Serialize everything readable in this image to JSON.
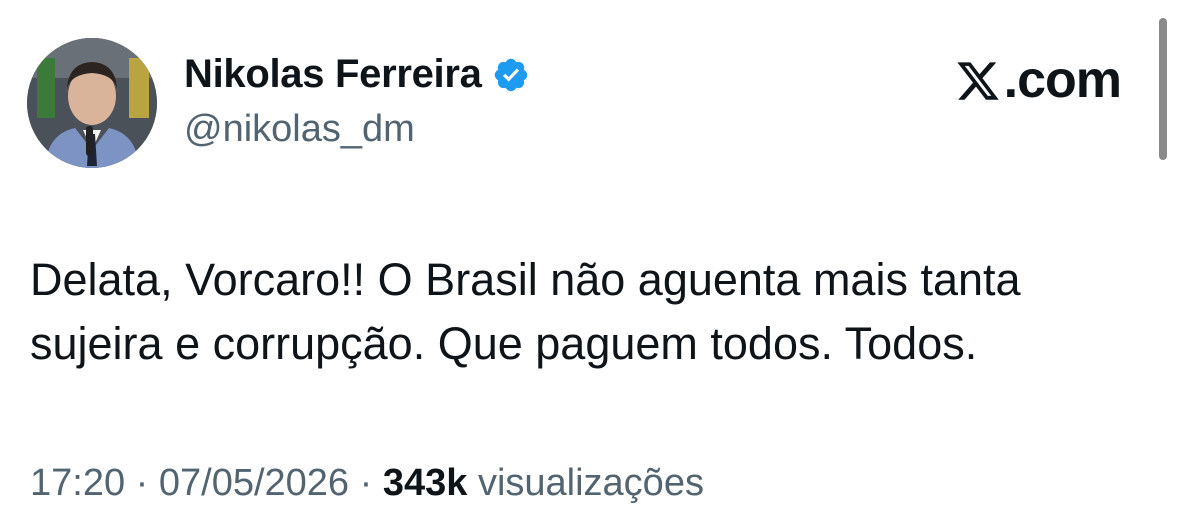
{
  "author": {
    "display_name": "Nikolas Ferreira",
    "handle": "@nikolas_dm",
    "verified_icon": "verified-badge-icon",
    "verified_color": "#1d9bf0"
  },
  "brand": {
    "label": ".com",
    "icon": "x-logo-icon"
  },
  "tweet": {
    "text": "Delata, Vorcaro!! O Brasil não aguenta mais tanta sujeira e corrupção. Que paguem todos. Todos."
  },
  "meta": {
    "time": "17:20",
    "separator": "·",
    "date": "07/05/2026",
    "views_count": "343k",
    "views_label": "visualizações"
  },
  "colors": {
    "text": "#0f1419",
    "muted": "#536471"
  }
}
